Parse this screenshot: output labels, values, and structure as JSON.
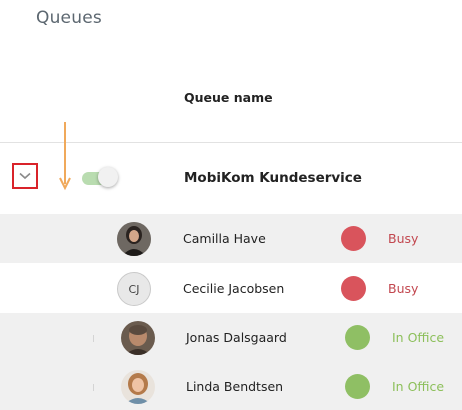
{
  "page": {
    "title": "Queues"
  },
  "table": {
    "column_header": "Queue name"
  },
  "queue": {
    "name": "MobiKom Kundeservice",
    "enabled": true,
    "switch_color": "#b9dcb0"
  },
  "members": [
    {
      "name": "Camilla Have",
      "status": "Busy",
      "status_color": "#d9545c",
      "status_text_color": "#c2474f",
      "avatar": "photo"
    },
    {
      "name": "Cecilie Jacobsen",
      "initials": "CJ",
      "status": "Busy",
      "status_color": "#d9545c",
      "status_text_color": "#c2474f",
      "avatar": "initials"
    },
    {
      "name": "Jonas Dalsgaard",
      "status": "In Office",
      "status_color": "#8fbf64",
      "status_text_color": "#8cbf5a",
      "avatar": "photo"
    },
    {
      "name": "Linda Bendtsen",
      "status": "In Office",
      "status_color": "#8fbf64",
      "status_text_color": "#8cbf5a",
      "avatar": "photo"
    }
  ],
  "colors": {
    "highlight_border": "#d9232a",
    "annotation_arrow": "#f0a95b",
    "row_alt": "#f0f0f0"
  },
  "icons": {
    "expand": "chevron-down-icon",
    "annotation": "arrow-down-icon"
  }
}
